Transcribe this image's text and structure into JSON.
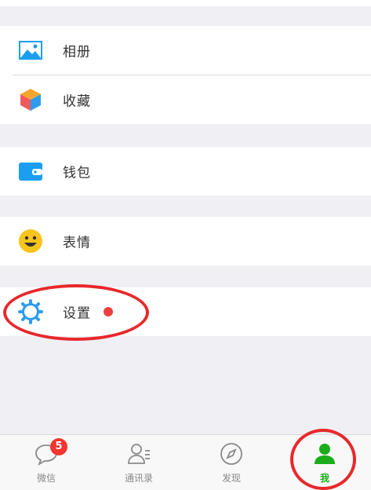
{
  "menu": {
    "group1": [
      {
        "id": "album",
        "label": "相册",
        "icon": "album-icon"
      },
      {
        "id": "favorites",
        "label": "收藏",
        "icon": "favorites-cube-icon"
      }
    ],
    "wallet": {
      "label": "钱包",
      "icon": "wallet-icon"
    },
    "stickers": {
      "label": "表情",
      "icon": "smiley-face-icon"
    },
    "settings": {
      "label": "设置",
      "icon": "gear-icon",
      "has_red_dot": true
    }
  },
  "tabbar": {
    "tabs": [
      {
        "label": "微信",
        "icon": "chat-bubble-icon",
        "badge": "5"
      },
      {
        "label": "通讯录",
        "icon": "contacts-icon"
      },
      {
        "label": "发现",
        "icon": "compass-icon"
      },
      {
        "label": "我",
        "icon": "person-icon",
        "active": true
      }
    ]
  },
  "colors": {
    "background": "#efeff4",
    "active_tab": "#1aad19",
    "badge": "#f43530",
    "annotation": "#e8282b",
    "album_icon": "#1b9ef0",
    "wallet_icon": "#1b9ef0",
    "gear_icon": "#2d9cf0",
    "smiley_icon": "#f8c51c"
  }
}
